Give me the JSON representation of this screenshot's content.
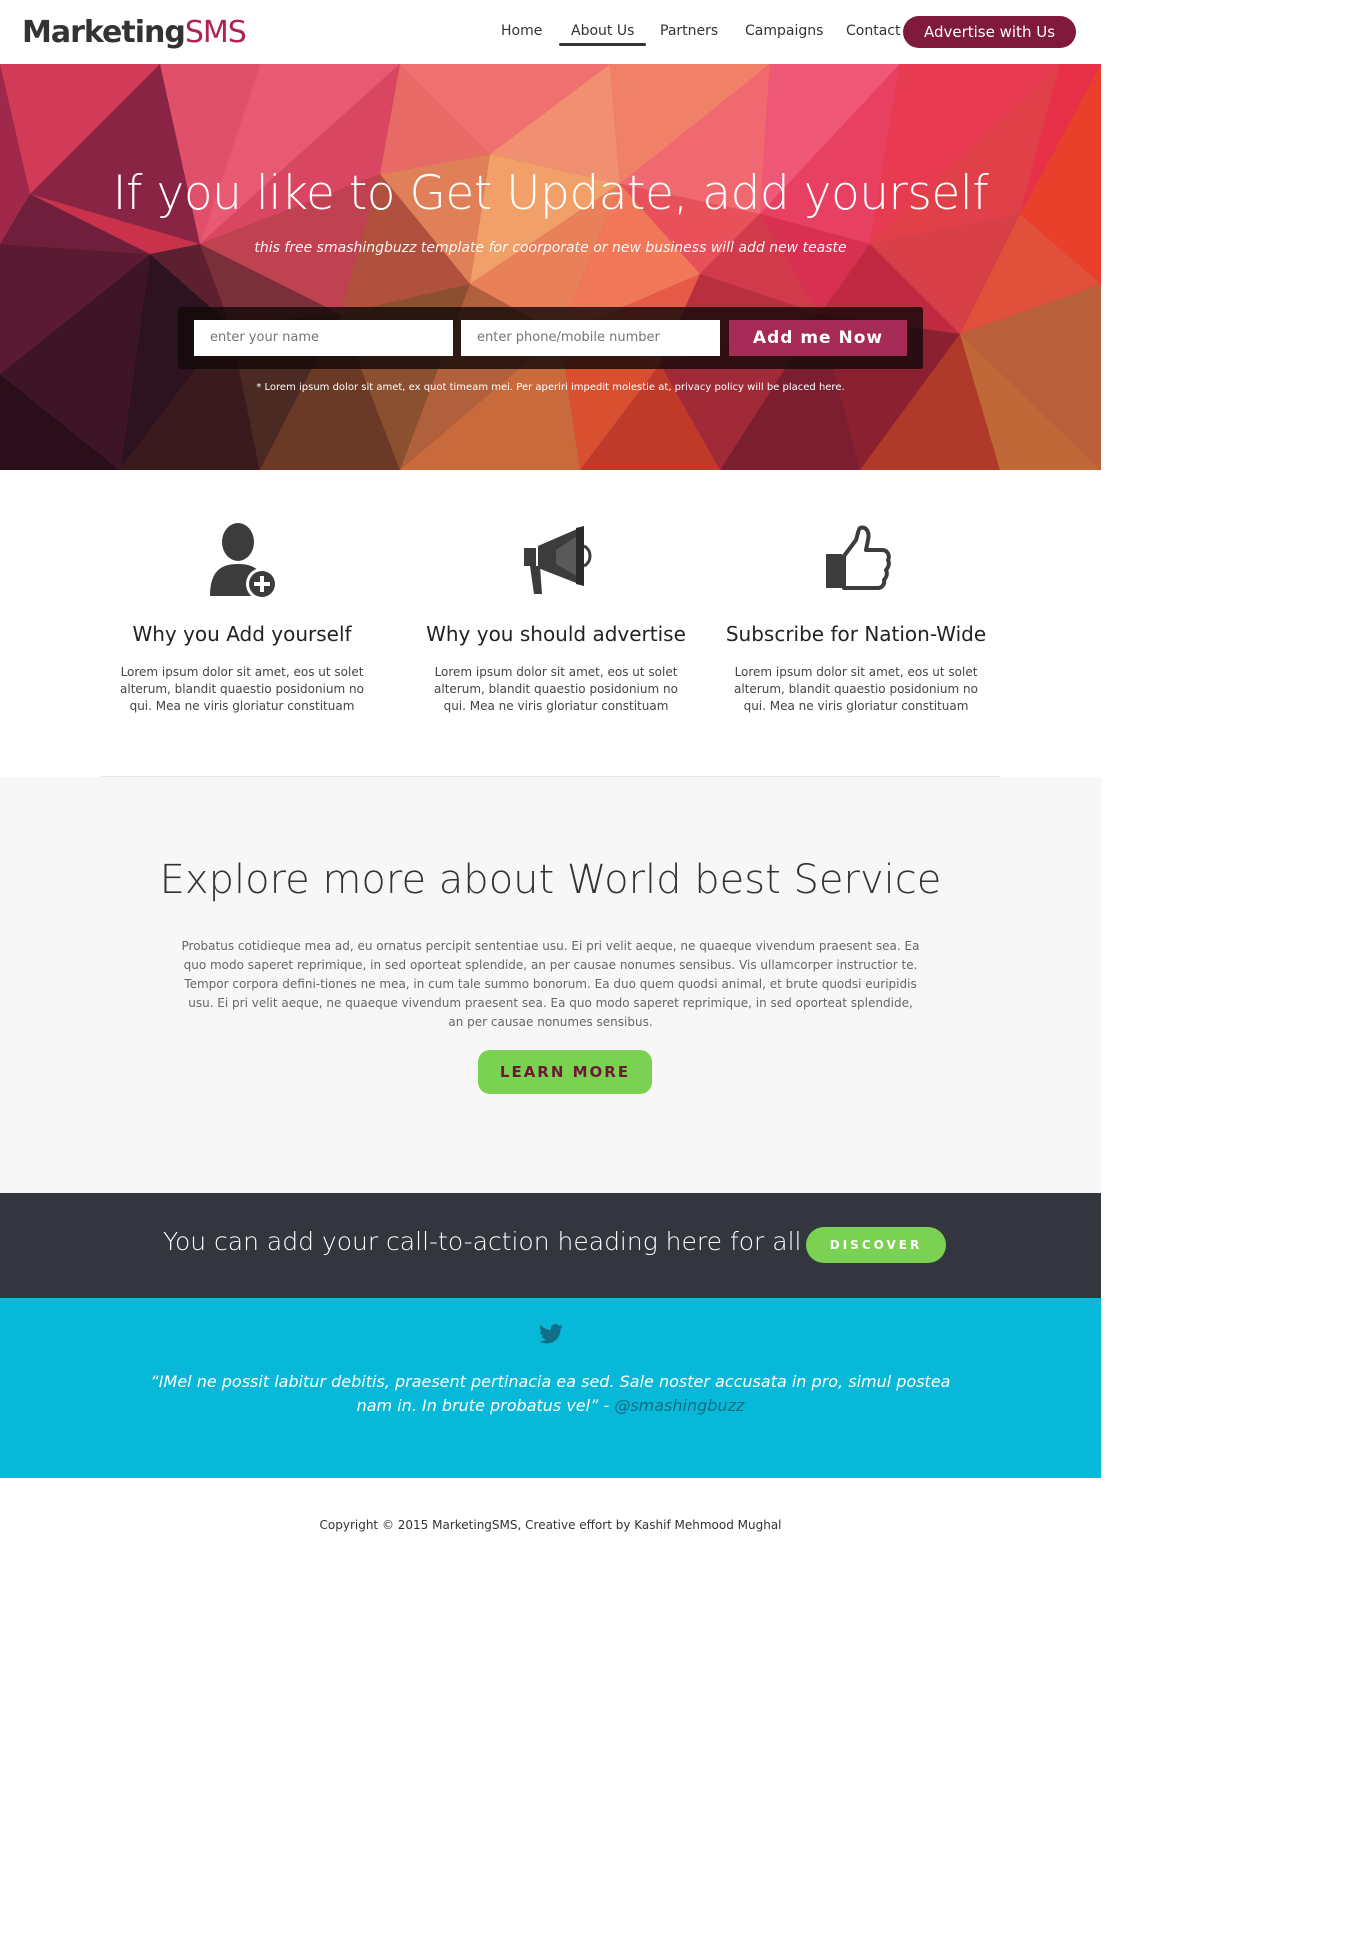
{
  "header": {
    "logo_part1": "Marketing",
    "logo_part2": "SMS",
    "nav": [
      {
        "label": "Home",
        "active": false
      },
      {
        "label": "About Us",
        "active": true
      },
      {
        "label": "Partners",
        "active": false
      },
      {
        "label": "Campaigns",
        "active": false
      },
      {
        "label": "Contact",
        "active": false
      }
    ],
    "advertise_label": "Advertise with Us"
  },
  "hero": {
    "title": "If you like to Get Update, add yourself",
    "subtitle": "this free smashingbuzz template for coorporate or new business will add new teaste",
    "name_placeholder": "enter your name",
    "phone_placeholder": "enter phone/mobile number",
    "submit_label": "Add me Now",
    "note": "* Lorem ipsum dolor sit amet, ex quot timeam mei. Per aperiri impedit molestie at, privacy policy will be placed here."
  },
  "features": [
    {
      "icon": "add-user-icon",
      "title": "Why you Add yourself",
      "text": "Lorem ipsum dolor sit amet, eos ut solet alterum, blandit quaestio posidonium no qui. Mea ne viris gloriatur constituam"
    },
    {
      "icon": "megaphone-icon",
      "title": "Why you should advertise",
      "text": "Lorem ipsum dolor sit amet, eos ut solet alterum, blandit quaestio posidonium no qui. Mea ne viris gloriatur constituam"
    },
    {
      "icon": "thumbs-up-icon",
      "title": "Subscribe for Nation-Wide",
      "text": "Lorem ipsum dolor sit amet, eos ut solet alterum, blandit quaestio posidonium no qui. Mea ne viris gloriatur constituam"
    }
  ],
  "explore": {
    "title": "Explore more about World best Service",
    "text": "Probatus cotidieque mea ad, eu ornatus percipit sententiae usu. Ei pri velit aeque, ne quaeque vivendum praesent sea. Ea quo modo saperet reprimique, in sed oporteat splendide, an per causae nonumes sensibus. Vis ullamcorper instructior te. Tempor corpora defini-tiones ne mea, in cum tale summo bonorum. Ea duo quem quodsi animal, et brute quodsi euripidis usu. Ei pri velit aeque, ne quaeque vivendum praesent sea. Ea quo modo saperet reprimique, in sed oporteat splendide, an per causae nonumes sensibus.",
    "button_label": "LEARN MORE"
  },
  "cta": {
    "heading": "You can add your call-to-action heading here for all",
    "button_label": "DISCOVER"
  },
  "tweet": {
    "icon": "twitter-icon",
    "quote": "“IMel ne possit labitur debitis, praesent pertinacia ea sed. Sale noster accusata in pro, simul postea nam in. In brute probatus vel”",
    "separator": " - ",
    "handle": "@smashingbuzz"
  },
  "footer": {
    "copyright": "Copyright © 2015 MarketingSMS, Creative effort by Kashif Mehmood Mughal"
  },
  "colors": {
    "brand": "#b0234e",
    "advertise_button": "#7f1a3c",
    "submit_button": "#a52a56",
    "green": "#7bd151",
    "cta_band": "#33363e",
    "twitter_band": "#08b8d9"
  }
}
